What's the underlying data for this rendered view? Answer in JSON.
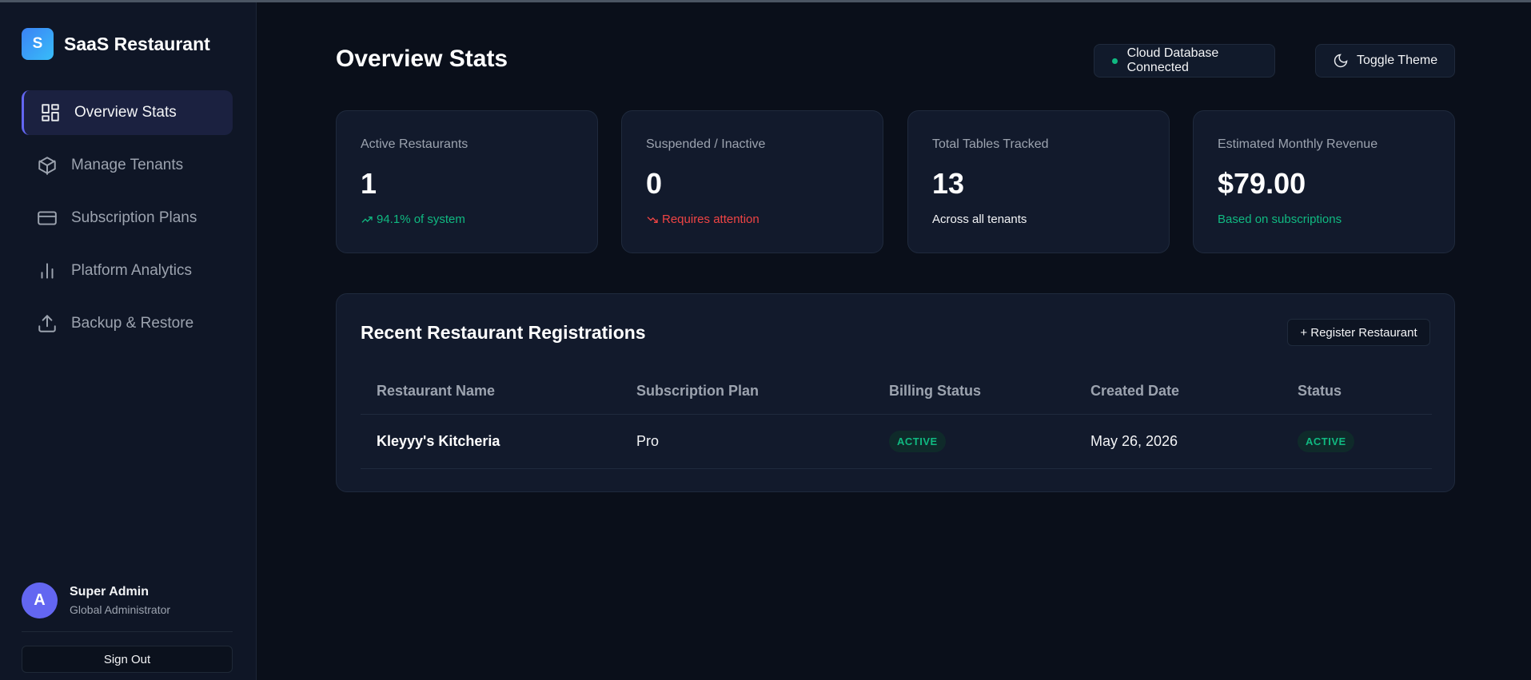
{
  "app": {
    "logo_letter": "S",
    "name": "SaaS Restaurant"
  },
  "sidebar": {
    "items": [
      {
        "label": "Overview Stats",
        "icon": "dashboard-icon",
        "active": true
      },
      {
        "label": "Manage Tenants",
        "icon": "box-icon"
      },
      {
        "label": "Subscription Plans",
        "icon": "credit-card-icon"
      },
      {
        "label": "Platform Analytics",
        "icon": "bar-chart-icon"
      },
      {
        "label": "Backup & Restore",
        "icon": "upload-icon"
      }
    ],
    "user": {
      "initial": "A",
      "name": "Super Admin",
      "role": "Global Administrator"
    },
    "sign_out": "Sign Out"
  },
  "header": {
    "title": "Overview Stats",
    "db_status": "Cloud Database Connected",
    "toggle_theme": "Toggle Theme"
  },
  "stats": [
    {
      "label": "Active Restaurants",
      "value": "1",
      "sub": "94.1% of system",
      "tone": "green",
      "icon": "trend-up-icon"
    },
    {
      "label": "Suspended / Inactive",
      "value": "0",
      "sub": "Requires attention",
      "tone": "red",
      "icon": "trend-down-icon"
    },
    {
      "label": "Total Tables Tracked",
      "value": "13",
      "sub": "Across all tenants",
      "tone": "white"
    },
    {
      "label": "Estimated Monthly Revenue",
      "value": "$79.00",
      "sub": "Based on subscriptions",
      "tone": "green"
    }
  ],
  "registrations": {
    "title": "Recent Restaurant Registrations",
    "register_button": "+ Register Restaurant",
    "columns": [
      "Restaurant Name",
      "Subscription Plan",
      "Billing Status",
      "Created Date",
      "Status"
    ],
    "rows": [
      {
        "name": "Kleyyy's Kitcheria",
        "plan": "Pro",
        "billing": "ACTIVE",
        "created": "May 26, 2026",
        "status": "ACTIVE"
      }
    ]
  },
  "colors": {
    "accent": "#6366f1",
    "success": "#10b981",
    "danger": "#ef4444",
    "background": "#0a0f1a"
  }
}
